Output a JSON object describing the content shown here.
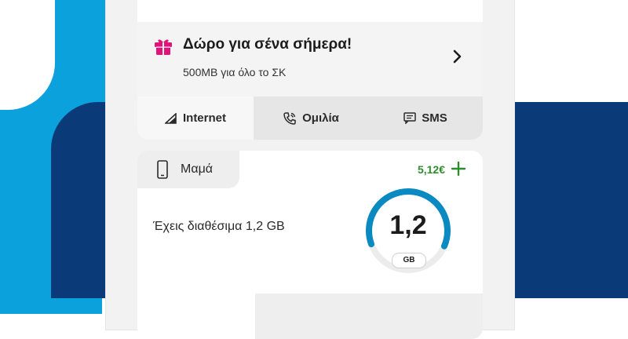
{
  "promo": {
    "title": "Δώρο για σένα σήμερα!",
    "subtitle": "500MB για όλο το ΣΚ",
    "gift_icon": "gift-icon",
    "chevron_icon": "chevron-right-icon"
  },
  "tabs": [
    {
      "label": "Internet",
      "icon": "signal-icon",
      "active": true
    },
    {
      "label": "Ομιλία",
      "icon": "phone-call-icon",
      "active": false
    },
    {
      "label": "SMS",
      "icon": "message-icon",
      "active": false
    }
  ],
  "line": {
    "name": "Μαμά",
    "balance": "5,12€",
    "available_text": "Έχεις διαθέσιμα 1,2 GB",
    "gauge_value": "1,2",
    "gauge_unit": "GB",
    "gauge_fraction": 0.62
  },
  "colors": {
    "gift": "#e0157c",
    "balance_green": "#2e8b2e",
    "gauge_blue": "#0b8ac2",
    "background_blue": "#0aa1dd",
    "background_navy": "#0b3a78"
  }
}
